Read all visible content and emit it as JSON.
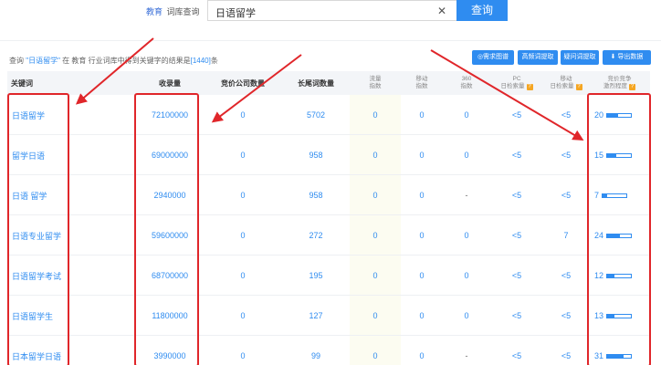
{
  "top": {
    "crumb_edu": "教育",
    "crumb_lexicon": "词库查询",
    "query": "日语留学",
    "clear": "✕",
    "search_button": "查询"
  },
  "info": {
    "prefix": "查询",
    "keyword": "\"日语留学\"",
    "mid": "在 教育 行业词库中得到关键字的结果是",
    "count": "[1440]",
    "suffix": "条"
  },
  "toolbar": {
    "demand_map": "需求图谱",
    "high_freq": "高频词提取",
    "question": "疑问词提取",
    "export": "导出数据"
  },
  "columns": {
    "keyword": "关键词",
    "indexed": "收录量",
    "bid_companies": "竞价公司数量",
    "longtail": "长尾词数量",
    "traffic_l1": "流量",
    "traffic_l2": "指数",
    "mobile_l1": "移动",
    "mobile_l2": "指数",
    "s360_l1": "360",
    "s360_l2": "指数",
    "pc_l1": "PC",
    "pc_l2": "日检索量",
    "mob_l1": "移动",
    "mob_l2": "日检索量",
    "comp_l1": "竞价竞争",
    "comp_l2": "激烈程度"
  },
  "rows": [
    {
      "keyword": "日语留学",
      "indexed": "72100000",
      "bid": "0",
      "longtail": "5702",
      "traffic": "0",
      "mobile": "0",
      "s360": "0",
      "pc": "<5",
      "mob": "<5",
      "comp": "20",
      "comp_level": 0.45
    },
    {
      "keyword": "留学日语",
      "indexed": "69000000",
      "bid": "0",
      "longtail": "958",
      "traffic": "0",
      "mobile": "0",
      "s360": "0",
      "pc": "<5",
      "mob": "<5",
      "comp": "15",
      "comp_level": 0.38
    },
    {
      "keyword": "日语 留学",
      "indexed": "2940000",
      "bid": "0",
      "longtail": "958",
      "traffic": "0",
      "mobile": "0",
      "s360": "-",
      "pc": "<5",
      "mob": "<5",
      "comp": "7",
      "comp_level": 0.18
    },
    {
      "keyword": "日语专业留学",
      "indexed": "59600000",
      "bid": "0",
      "longtail": "272",
      "traffic": "0",
      "mobile": "0",
      "s360": "0",
      "pc": "<5",
      "mob": "7",
      "comp": "24",
      "comp_level": 0.55
    },
    {
      "keyword": "日语留学考试",
      "indexed": "68700000",
      "bid": "0",
      "longtail": "195",
      "traffic": "0",
      "mobile": "0",
      "s360": "0",
      "pc": "<5",
      "mob": "<5",
      "comp": "12",
      "comp_level": 0.3
    },
    {
      "keyword": "日语留学生",
      "indexed": "11800000",
      "bid": "0",
      "longtail": "127",
      "traffic": "0",
      "mobile": "0",
      "s360": "0",
      "pc": "<5",
      "mob": "<5",
      "comp": "13",
      "comp_level": 0.32
    },
    {
      "keyword": "日本留学日语",
      "indexed": "3990000",
      "bid": "0",
      "longtail": "99",
      "traffic": "0",
      "mobile": "0",
      "s360": "-",
      "pc": "<5",
      "mob": "<5",
      "comp": "31",
      "comp_level": 0.7
    }
  ],
  "colors": {
    "accent": "#2f8cf0",
    "annotation": "#e0262a",
    "help": "#f5a623"
  }
}
